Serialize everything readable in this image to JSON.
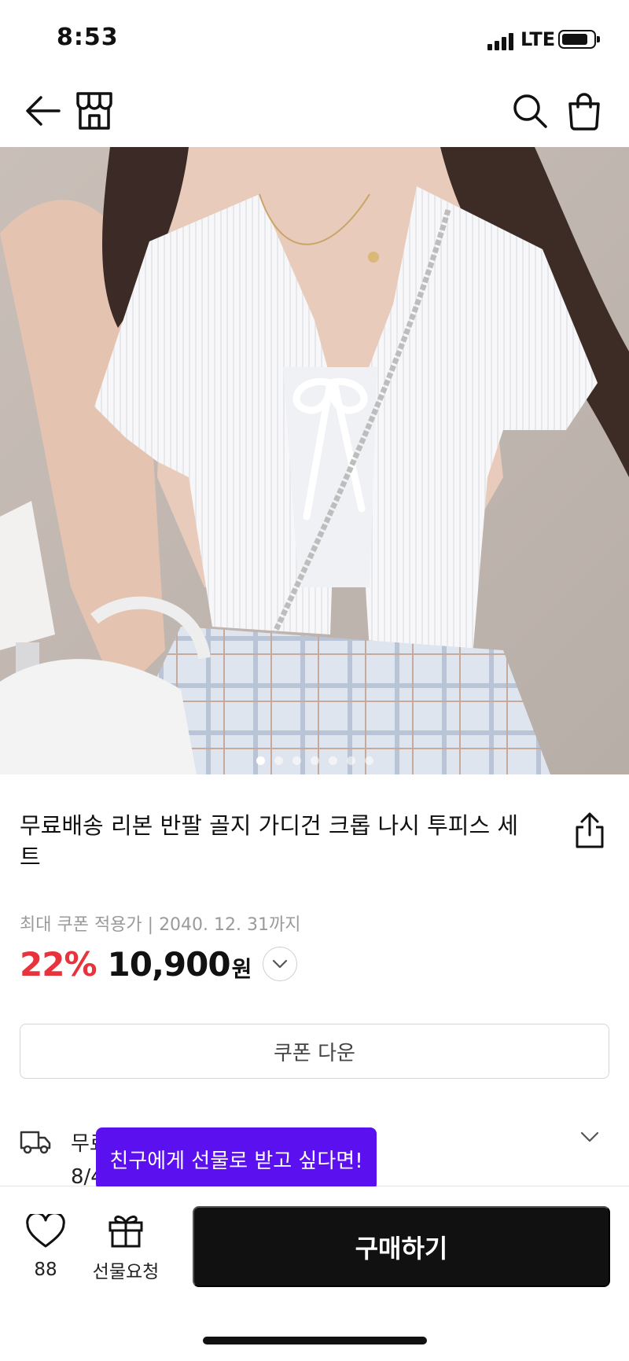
{
  "status_bar": {
    "time": "8:53",
    "network": "LTE",
    "battery_level": 0.85
  },
  "nav": {
    "icons": [
      "back-arrow-icon",
      "store-icon",
      "search-icon",
      "shopping-bag-icon"
    ]
  },
  "gallery": {
    "image_count": 7,
    "active_index": 0
  },
  "product": {
    "title": "무료배송 리본 반팔 골지 가디건 크롭 나시 투피스 세트",
    "coupon_note": "최대 쿠폰 적용가 | 2040. 12. 31까지",
    "discount": "22%",
    "price": "10,900",
    "currency": "원"
  },
  "coupon_button": {
    "label": "쿠폰 다운"
  },
  "shipping": {
    "text": "무료",
    "date": "8/4"
  },
  "tooltip": {
    "text": "친구에게 선물로 받고 싶다면!"
  },
  "bottom_bar": {
    "like_count": "88",
    "gift_label": "선물요청",
    "buy_label": "구매하기"
  },
  "colors": {
    "discount": "#e8323c",
    "tooltip_bg": "#5b10f0",
    "buy_bg": "#111111"
  }
}
